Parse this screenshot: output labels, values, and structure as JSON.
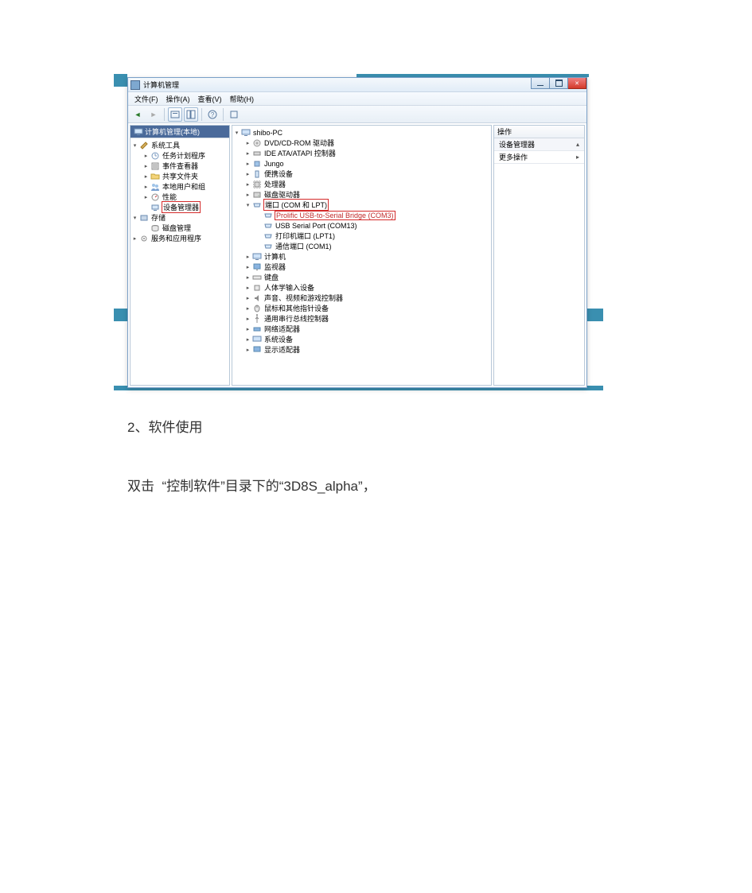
{
  "window": {
    "title": "计算机管理",
    "menus": [
      "文件(F)",
      "操作(A)",
      "查看(V)",
      "帮助(H)"
    ]
  },
  "left_tree": {
    "root": "计算机管理(本地)",
    "sys_tools": "系统工具",
    "task_sched": "任务计划程序",
    "event_viewer": "事件查看器",
    "shared": "共享文件夹",
    "local_users": "本地用户和组",
    "perf": "性能",
    "devmgr": "设备管理器",
    "storage": "存储",
    "diskmgmt": "磁盘管理",
    "services": "服务和应用程序"
  },
  "mid_tree": {
    "root": "shibo-PC",
    "dvd": "DVD/CD-ROM 驱动器",
    "ide": "IDE ATA/ATAPI 控制器",
    "jungo": "Jungo",
    "portable": "便携设备",
    "cpu": "处理器",
    "disk": "磁盘驱动器",
    "ports": "端口 (COM 和 LPT)",
    "com3": "Prolific USB-to-Serial Bridge (COM3)",
    "com13": "USB Serial Port (COM13)",
    "lpt1": "打印机端口 (LPT1)",
    "com1": "通信端口 (COM1)",
    "computer": "计算机",
    "monitor": "监视器",
    "keyboard": "键盘",
    "hid": "人体学输入设备",
    "sound": "声音、视频和游戏控制器",
    "mouse": "鼠标和其他指针设备",
    "usb": "通用串行总线控制器",
    "network": "网络适配器",
    "system": "系统设备",
    "display": "显示适配器"
  },
  "right_panel": {
    "header": "操作",
    "row1": "设备管理器",
    "row2": "更多操作"
  },
  "doc": {
    "heading": "2、软件使用",
    "para": "双击  “控制软件”目录下的“3D8S_alpha”，"
  }
}
